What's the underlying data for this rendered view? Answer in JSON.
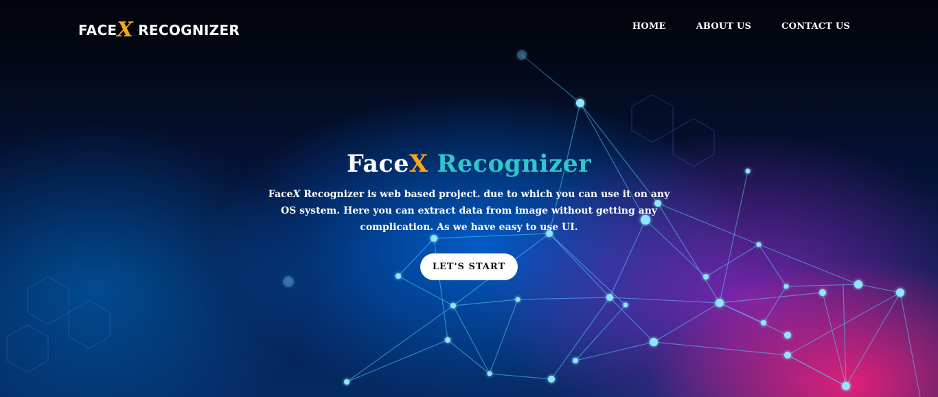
{
  "brand": {
    "face": "FACE",
    "x": "X",
    "rest": "RECOGNIZER"
  },
  "nav": [
    {
      "label": "HOME"
    },
    {
      "label": "ABOUT US"
    },
    {
      "label": "CONTACT US"
    }
  ],
  "hero": {
    "title_face": "Face",
    "title_x": "X",
    "title_rest": " Recognizer",
    "desc_face": "Face",
    "desc_x": "X",
    "desc_rest": " Recognizer is web based project. due to which you can use it on any OS system. Here you can extract data from image without getting any complication. As we have easy to use UI.",
    "cta_label": "LET'S START"
  },
  "colors": {
    "accent_orange": "#f5a623",
    "accent_teal": "#2fc6cc"
  }
}
